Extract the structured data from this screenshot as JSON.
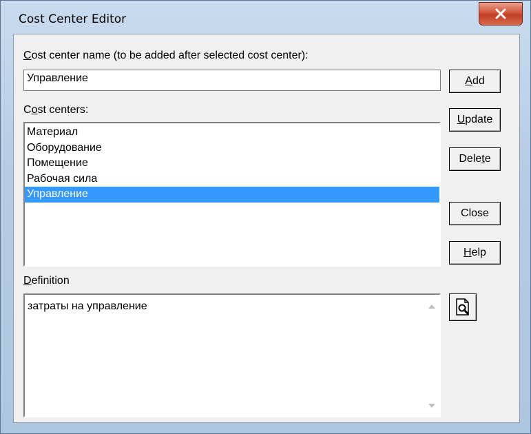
{
  "window": {
    "title": "Cost Center Editor"
  },
  "name_field": {
    "label_first": "C",
    "label_rest": "ost center name (to be added after selected cost center):",
    "value": "Управление"
  },
  "list": {
    "label_first": "C",
    "label_u": "o",
    "label_rest": "st centers:",
    "items": [
      "Материал",
      "Оборудование",
      "Помещение",
      "Рабочая сила",
      "Управление"
    ],
    "selected_index": 4
  },
  "definition": {
    "label_u": "D",
    "label_rest": "efinition",
    "value": "затраты на управление"
  },
  "buttons": {
    "add": {
      "u": "A",
      "rest": "dd"
    },
    "update": {
      "u": "U",
      "rest": "pdate"
    },
    "delete": {
      "pre": "Dele",
      "u": "t",
      "rest": "e"
    },
    "close": {
      "label": "Close"
    },
    "help": {
      "u": "H",
      "rest": "elp"
    }
  },
  "icons": {
    "close": "close-x-icon",
    "browse": "page-magnifier-icon"
  }
}
